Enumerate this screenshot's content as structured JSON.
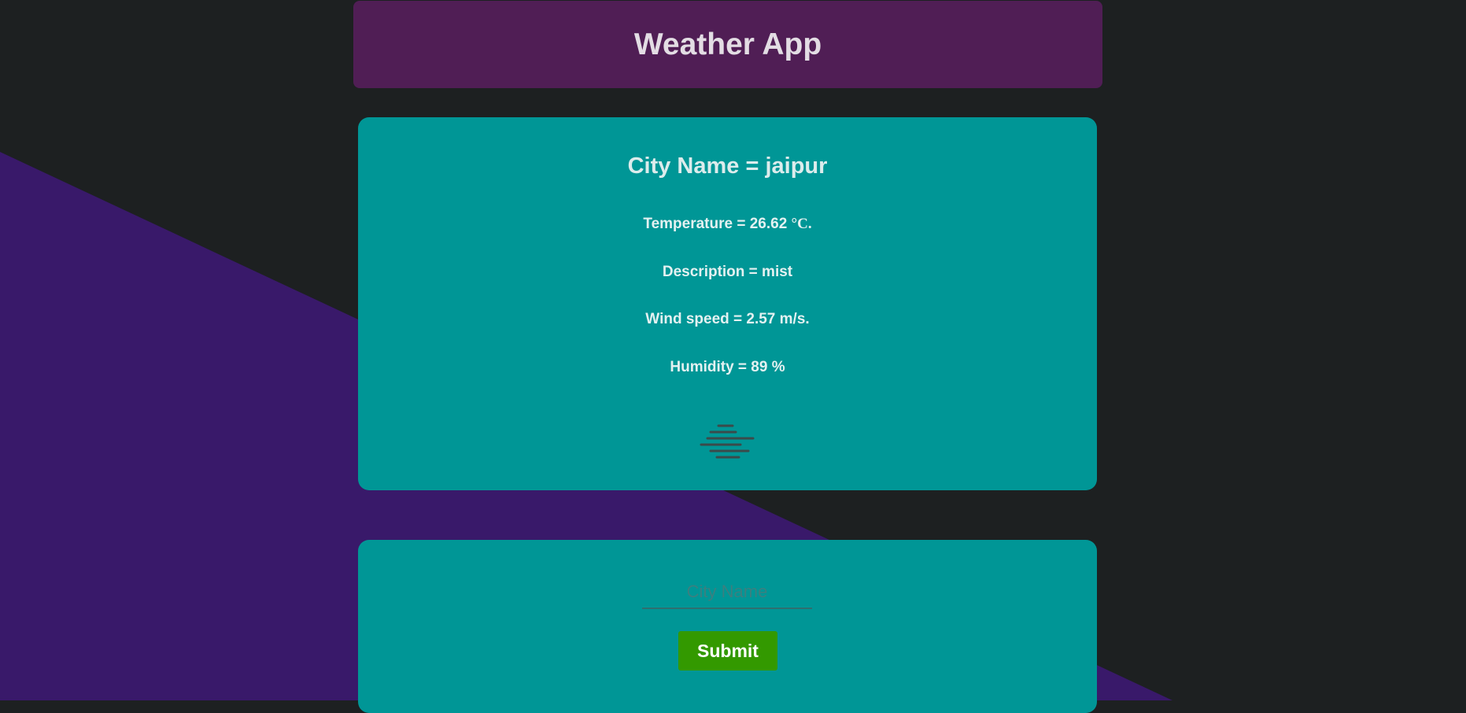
{
  "app": {
    "title": "Weather App"
  },
  "weather": {
    "city_line": "City Name = jaipur",
    "temperature_prefix": "Temperature = 26.62 ",
    "temperature_unit": "°C.",
    "description_line": "Description = mist",
    "wind_line": "Wind speed = 2.57 m/s.",
    "humidity_line": "Humidity = 89 %",
    "icon": "mist-icon"
  },
  "form": {
    "city_placeholder": "City Name",
    "city_value": "",
    "submit_label": "Submit"
  },
  "colors": {
    "page_background": "#1d2021",
    "accent_shape": "#39196a",
    "header_background": "#501e55",
    "card_background": "#009696",
    "submit_button": "#339900"
  }
}
